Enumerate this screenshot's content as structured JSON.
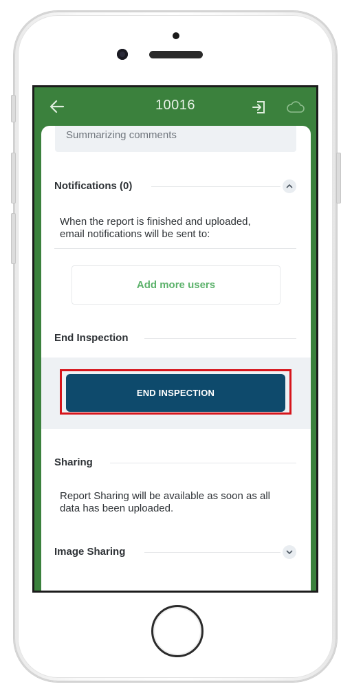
{
  "header": {
    "title": "10016",
    "back_icon": "arrow-left-icon",
    "exit_icon": "exit-icon",
    "cloud_icon": "cloud-icon"
  },
  "comments": {
    "placeholder": "Summarizing comments"
  },
  "notifications": {
    "heading": "Notifications (0)",
    "toggle_icon": "chevron-up-icon",
    "message_line1": "When the report is finished and uploaded,",
    "message_line2": "email notifications will be sent to:",
    "add_users_label": "Add more users"
  },
  "end_inspection": {
    "heading": "End Inspection",
    "button_label": "END INSPECTION"
  },
  "sharing": {
    "heading": "Sharing",
    "message_line1": "Report Sharing will be available as soon as all",
    "message_line2": "data has been uploaded."
  },
  "image_sharing": {
    "heading": "Image Sharing",
    "toggle_icon": "chevron-down-icon"
  },
  "colors": {
    "header_green": "#3b813d",
    "button_navy": "#0e4a6c",
    "link_green": "#5cb26b",
    "highlight_red": "#d6151b"
  }
}
